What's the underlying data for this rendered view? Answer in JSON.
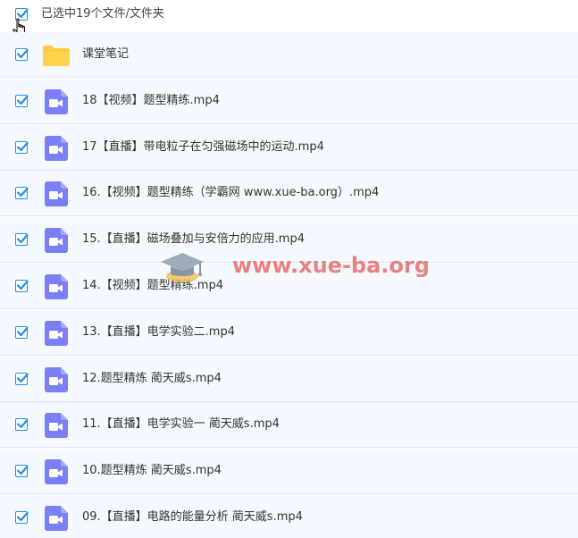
{
  "header": {
    "select_all_checked": true,
    "selection_summary": "已选中19个文件/文件夹"
  },
  "files": [
    {
      "name": "课堂笔记",
      "type": "folder",
      "checked": true
    },
    {
      "name": "18【视频】题型精练.mp4",
      "type": "video",
      "checked": true
    },
    {
      "name": "17【直播】带电粒子在匀强磁场中的运动.mp4",
      "type": "video",
      "checked": true
    },
    {
      "name": "16.【视频】题型精练（学霸网 www.xue-ba.org）.mp4",
      "type": "video",
      "checked": true
    },
    {
      "name": "15.【直播】磁场叠加与安倍力的应用.mp4",
      "type": "video",
      "checked": true
    },
    {
      "name": "14.【视频】题型精练.mp4",
      "type": "video",
      "checked": true
    },
    {
      "name": "13.【直播】电学实验二.mp4",
      "type": "video",
      "checked": true
    },
    {
      "name": "12.题型精炼 蔺天威s.mp4",
      "type": "video",
      "checked": true
    },
    {
      "name": "11.【直播】电学实验一 蔺天威s.mp4",
      "type": "video",
      "checked": true
    },
    {
      "name": "10.题型精炼 蔺天威s.mp4",
      "type": "video",
      "checked": true
    },
    {
      "name": "09.【直播】电路的能量分析 蔺天威s.mp4",
      "type": "video",
      "checked": true
    }
  ],
  "watermark": {
    "text": "www.xue-ba.org"
  },
  "colors": {
    "checkbox_border": "#1e90e8",
    "checkmark": "#1e90e8",
    "row_background": "#f3f9fe",
    "row_divider": "#dde7ee",
    "folder": "#ffcb3d",
    "video_icon": "#7b7ff5",
    "watermark": "#e65050"
  },
  "icons": {
    "folder": "folder-icon",
    "video": "video-file-icon",
    "cursor": "hand-pointer-icon",
    "watermark_logo": "graduation-cap-icon"
  }
}
